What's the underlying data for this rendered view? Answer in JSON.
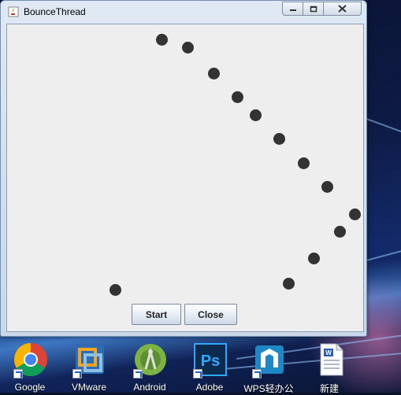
{
  "window": {
    "title": "BounceThread",
    "controls": {
      "minimize": "minimize",
      "maximize": "maximize",
      "close": "close"
    }
  },
  "balls": {
    "count": 13,
    "color": "#333333"
  },
  "buttons": {
    "start_label": "Start",
    "close_label": "Close"
  },
  "desktop_icons": [
    {
      "label": "Google",
      "icon": "chrome-icon"
    },
    {
      "label": "VMware",
      "icon": "vmware-icon"
    },
    {
      "label": "Android",
      "icon": "android-studio-icon"
    },
    {
      "label": "Adobe",
      "icon": "photoshop-icon"
    },
    {
      "label": "WPS轻办公",
      "icon": "wps-icon"
    },
    {
      "label": "新建",
      "icon": "document-icon"
    }
  ]
}
